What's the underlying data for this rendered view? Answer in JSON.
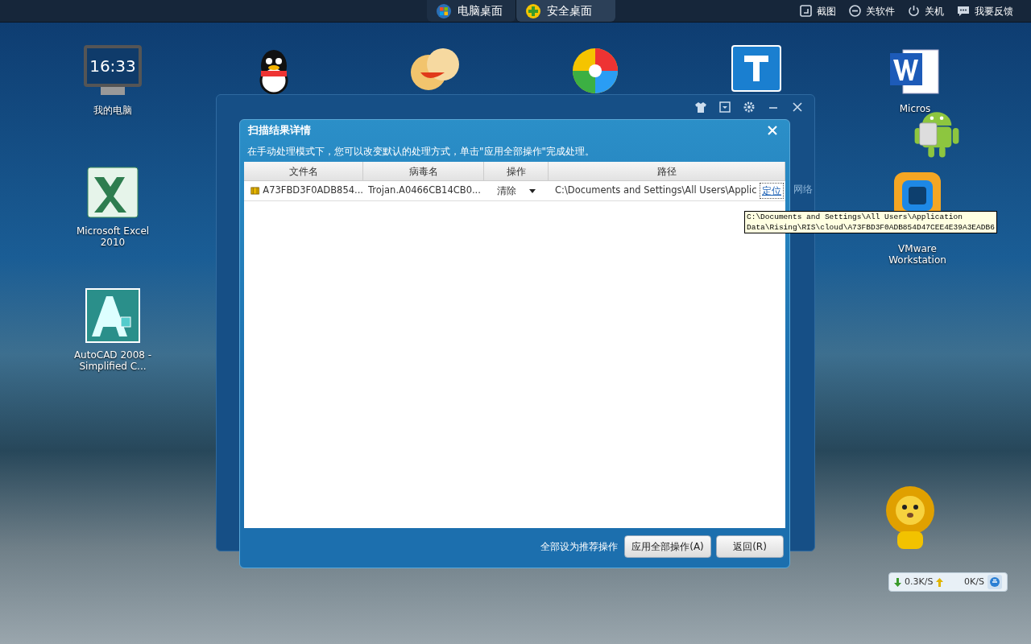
{
  "top_bar": {
    "tabs": [
      {
        "label": "电脑桌面",
        "selected": false,
        "kind": "windows"
      },
      {
        "label": "安全桌面",
        "selected": true,
        "kind": "shield"
      }
    ],
    "actions": [
      {
        "label": "截图",
        "kind": "screenshot"
      },
      {
        "label": "关软件",
        "kind": "close"
      },
      {
        "label": "关机",
        "kind": "power"
      },
      {
        "label": "我要反馈",
        "kind": "feedback"
      }
    ]
  },
  "desktop_icons": [
    {
      "kind": "computer",
      "label": "我的电脑",
      "clock": "16:33"
    },
    {
      "kind": "excel",
      "label": "Microsoft Excel 2010"
    },
    {
      "kind": "autocad",
      "label": "AutoCAD 2008 - Simplified C..."
    },
    {
      "kind": "penguin"
    },
    {
      "kind": "chat"
    },
    {
      "kind": "pinwheel"
    },
    {
      "kind": "t-app"
    },
    {
      "kind": "word",
      "label": "Micros"
    },
    {
      "kind": "android"
    },
    {
      "kind": "vmware",
      "label": "VMware Workstation"
    },
    {
      "kind": "lion"
    }
  ],
  "background_window": {
    "side_label": "网络"
  },
  "dialog": {
    "title": "扫描结果详情",
    "instruction": "在手动处理模式下，您可以改变默认的处理方式，单击\"应用全部操作\"完成处理。",
    "columns": [
      "文件名",
      "病毒名",
      "操作",
      "路径"
    ],
    "rows": [
      {
        "file": "A73FBD3F0ADB854...",
        "virus": "Trojan.A0466CB14CB0...",
        "action": "清除",
        "path": "C:\\Documents and Settings\\All Users\\Applic",
        "locate": "定位"
      }
    ],
    "tooltip": [
      "C:\\Documents and Settings\\All Users\\Application",
      "Data\\Rising\\RIS\\cloud\\A73FBD3F0ADB854D47CEE4E39A3EADB6"
    ],
    "footer_link": "全部设为推荐操作",
    "buttons": [
      "应用全部操作(A)",
      "返回(R)"
    ]
  },
  "net_widget": {
    "down": "0.3K/S",
    "up": "0K/S"
  }
}
